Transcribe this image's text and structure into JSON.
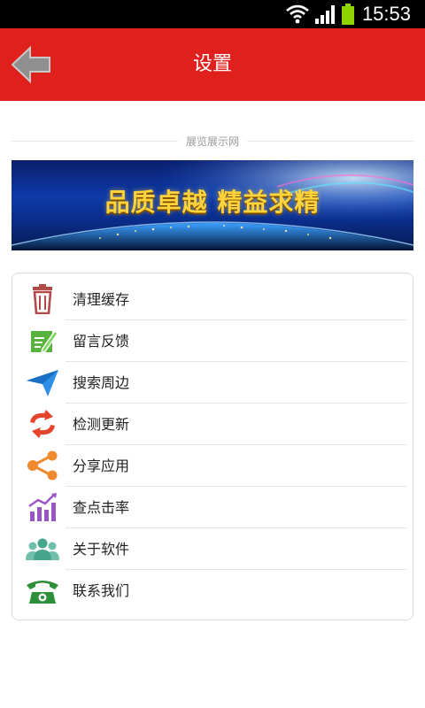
{
  "status_bar": {
    "time": "15:53"
  },
  "header": {
    "title": "设置",
    "back_icon": "back-arrow-icon"
  },
  "section": {
    "label": "展览展示网"
  },
  "banner": {
    "text": "品质卓越  精益求精"
  },
  "menu": {
    "items": [
      {
        "label": "清理缓存",
        "icon": "trash-icon",
        "color": "#b24a4a"
      },
      {
        "label": "留言反馈",
        "icon": "edit-note-icon",
        "color": "#57b33d"
      },
      {
        "label": "搜索周边",
        "icon": "navigation-arrow-icon",
        "color": "#2f8ee8"
      },
      {
        "label": "检测更新",
        "icon": "refresh-icon",
        "color": "#e5452d"
      },
      {
        "label": "分享应用",
        "icon": "share-icon",
        "color": "#f08a2e"
      },
      {
        "label": "查点击率",
        "icon": "chart-icon",
        "color": "#9b54c4"
      },
      {
        "label": "关于软件",
        "icon": "people-icon",
        "color": "#46a58c"
      },
      {
        "label": "联系我们",
        "icon": "phone-icon",
        "color": "#2e8f3a"
      }
    ]
  }
}
